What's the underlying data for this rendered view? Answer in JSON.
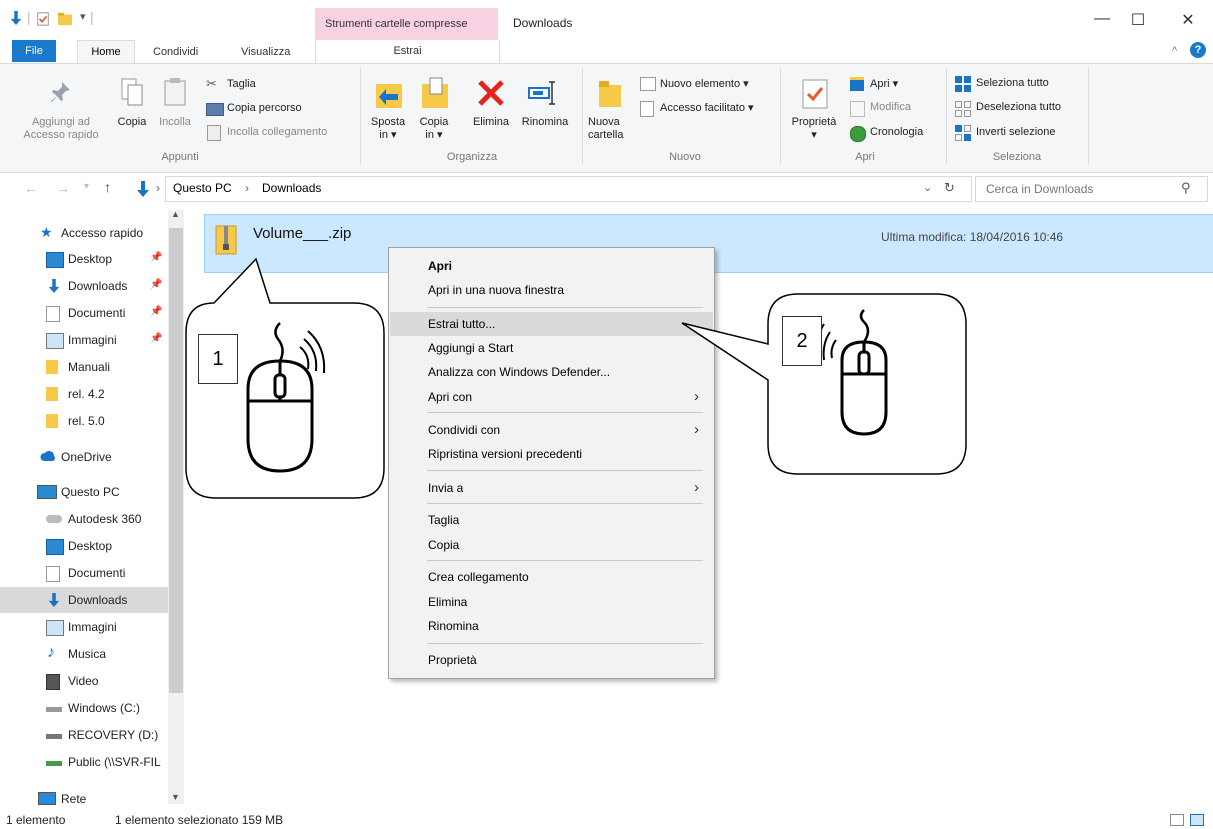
{
  "window": {
    "title": "Downloads",
    "context_tab_title": "Strumenti cartelle compresse"
  },
  "tabs": {
    "file": "File",
    "home": "Home",
    "share": "Condividi",
    "view": "Visualizza",
    "extract": "Estrai"
  },
  "ribbon": {
    "clipboard": {
      "pin": "Aggiungi ad\nAccesso rapido",
      "copy": "Copia",
      "paste": "Incolla",
      "cut": "Taglia",
      "copy_path": "Copia percorso",
      "paste_shortcut": "Incolla collegamento",
      "group": "Appunti"
    },
    "organize": {
      "move": "Sposta\nin ▾",
      "copy_to": "Copia\nin ▾",
      "delete": "Elimina",
      "rename": "Rinomina",
      "group": "Organizza"
    },
    "new": {
      "new_folder": "Nuova\ncartella",
      "new_item": "Nuovo elemento ▾",
      "easy_access": "Accesso facilitato ▾",
      "group": "Nuovo"
    },
    "open": {
      "properties": "Proprietà\n▾",
      "open": "Apri ▾",
      "edit": "Modifica",
      "history": "Cronologia",
      "group": "Apri"
    },
    "select": {
      "select_all": "Seleziona tutto",
      "select_none": "Deseleziona tutto",
      "invert": "Inverti selezione",
      "group": "Seleziona"
    }
  },
  "address": {
    "crumb_pc": "Questo PC",
    "crumb_downloads": "Downloads",
    "search_placeholder": "Cerca in Downloads"
  },
  "nav": {
    "quick_access": "Accesso rapido",
    "quick": [
      "Desktop",
      "Downloads",
      "Documenti",
      "Immagini",
      "Manuali",
      "rel. 4.2",
      "rel. 5.0"
    ],
    "onedrive": "OneDrive",
    "this_pc": "Questo PC",
    "pc_items": [
      "Autodesk 360",
      "Desktop",
      "Documenti",
      "Downloads",
      "Immagini",
      "Musica",
      "Video",
      "Windows (C:)",
      "RECOVERY (D:)",
      "Public (\\\\SVR-FIL"
    ],
    "network": "Rete"
  },
  "file": {
    "name": "Volume___.zip",
    "modified": "Ultima modifica: 18/04/2016 10:46"
  },
  "context_menu": {
    "open": "Apri",
    "open_new_window": "Apri in una nuova finestra",
    "extract_all": "Estrai tutto...",
    "pin_start": "Aggiungi a Start",
    "defender": "Analizza con Windows Defender...",
    "open_with": "Apri con",
    "share_with": "Condividi con",
    "restore": "Ripristina versioni precedenti",
    "send_to": "Invia a",
    "cut": "Taglia",
    "copy": "Copia",
    "create_shortcut": "Crea collegamento",
    "delete": "Elimina",
    "rename": "Rinomina",
    "properties": "Proprietà"
  },
  "callouts": {
    "one": "1",
    "two": "2"
  },
  "status": {
    "count": "1 elemento",
    "selected": "1 elemento selezionato  159 MB"
  },
  "colors": {
    "accent": "#1979ca",
    "selection": "#cce8ff",
    "context_tab": "#f8d2e2"
  }
}
